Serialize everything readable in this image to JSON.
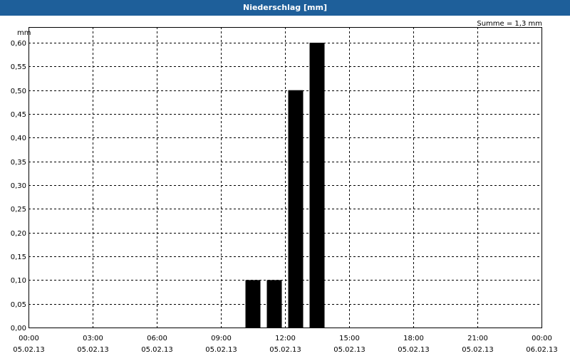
{
  "window": {
    "title": "Niederschlag [mm]"
  },
  "chart_data": {
    "type": "bar",
    "ylabel": "mm",
    "annotation": "Summe = 1,3 mm",
    "ylim": [
      0,
      0.6
    ],
    "y_ticks": [
      "0,00",
      "0,05",
      "0,10",
      "0,15",
      "0,20",
      "0,25",
      "0,30",
      "0,35",
      "0,40",
      "0,45",
      "0,50",
      "0,55",
      "0,60"
    ],
    "x_range_hours": [
      0,
      24
    ],
    "x_ticks": [
      {
        "time": "00:00",
        "date": "05.02.13"
      },
      {
        "time": "03:00",
        "date": "05.02.13"
      },
      {
        "time": "06:00",
        "date": "05.02.13"
      },
      {
        "time": "09:00",
        "date": "05.02.13"
      },
      {
        "time": "12:00",
        "date": "05.02.13"
      },
      {
        "time": "15:00",
        "date": "05.02.13"
      },
      {
        "time": "18:00",
        "date": "05.02.13"
      },
      {
        "time": "21:00",
        "date": "05.02.13"
      },
      {
        "time": "00:00",
        "date": "06.02.13"
      }
    ],
    "bar_color": "#000000",
    "grid": true,
    "series": [
      {
        "x_hours": [
          10.5,
          11.5,
          12.5,
          13.5
        ],
        "values": [
          0.1,
          0.1,
          0.5,
          0.6
        ]
      }
    ]
  }
}
